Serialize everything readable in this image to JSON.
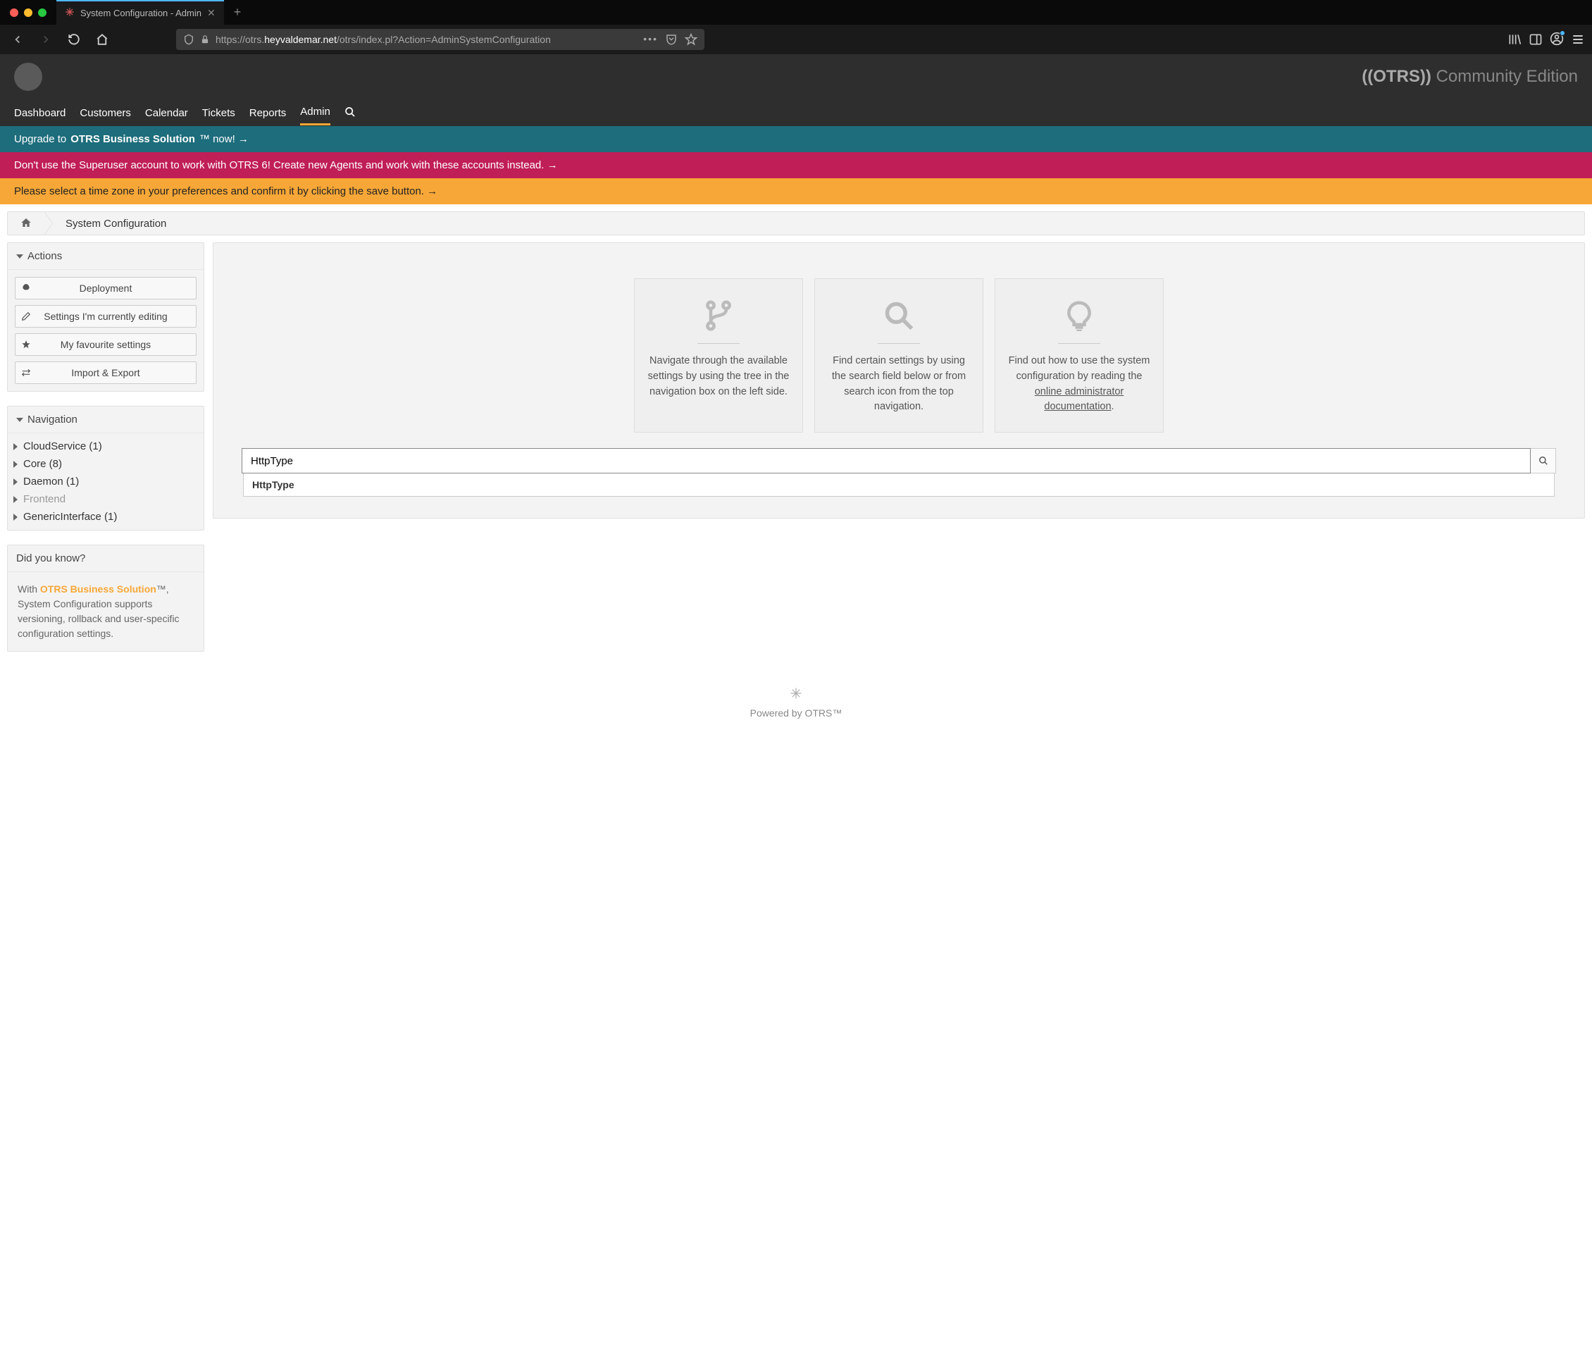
{
  "browser": {
    "tab_title": "System Configuration - Admin",
    "url_prefix": "https://otrs.",
    "url_domain": "heyvaldemar.net",
    "url_suffix": "/otrs/index.pl?Action=AdminSystemConfiguration"
  },
  "header": {
    "brand_otrs": "((OTRS))",
    "brand_edition": "Community Edition",
    "nav": [
      "Dashboard",
      "Customers",
      "Calendar",
      "Tickets",
      "Reports",
      "Admin"
    ],
    "active_nav": "Admin"
  },
  "banners": {
    "teal_pre": "Upgrade to ",
    "teal_bold": "OTRS Business Solution",
    "teal_post": "™ now! →",
    "pink": "Don't use the Superuser account to work with OTRS 6! Create new Agents and work with these accounts instead. →",
    "yellow": "Please select a time zone in your preferences and confirm it by clicking the save button. →"
  },
  "breadcrumb": {
    "current": "System Configuration"
  },
  "actions": {
    "title": "Actions",
    "items": [
      "Deployment",
      "Settings I'm currently editing",
      "My favourite settings",
      "Import & Export"
    ]
  },
  "navigation": {
    "title": "Navigation",
    "items": [
      {
        "label": "CloudService (1)",
        "muted": false
      },
      {
        "label": "Core (8)",
        "muted": false
      },
      {
        "label": "Daemon (1)",
        "muted": false
      },
      {
        "label": "Frontend",
        "muted": true
      },
      {
        "label": "GenericInterface (1)",
        "muted": false
      }
    ]
  },
  "didyouknow": {
    "title": "Did you know?",
    "pre": "With ",
    "obs": "OTRS Business Solution",
    "post": "™, System Configuration supports versioning, rollback and user-specific configuration settings."
  },
  "cards": {
    "nav_text": "Navigate through the available settings by using the tree in the navigation box on the left side.",
    "search_text": "Find certain settings by using the search field below or from search icon from the top navigation.",
    "doc_text_pre": "Find out how to use the system configuration by reading the ",
    "doc_link": "online administrator documentation",
    "doc_text_post": "."
  },
  "search": {
    "value": "HttpType",
    "suggestion": "HttpType"
  },
  "footer": {
    "powered": "Powered by OTRS™"
  }
}
